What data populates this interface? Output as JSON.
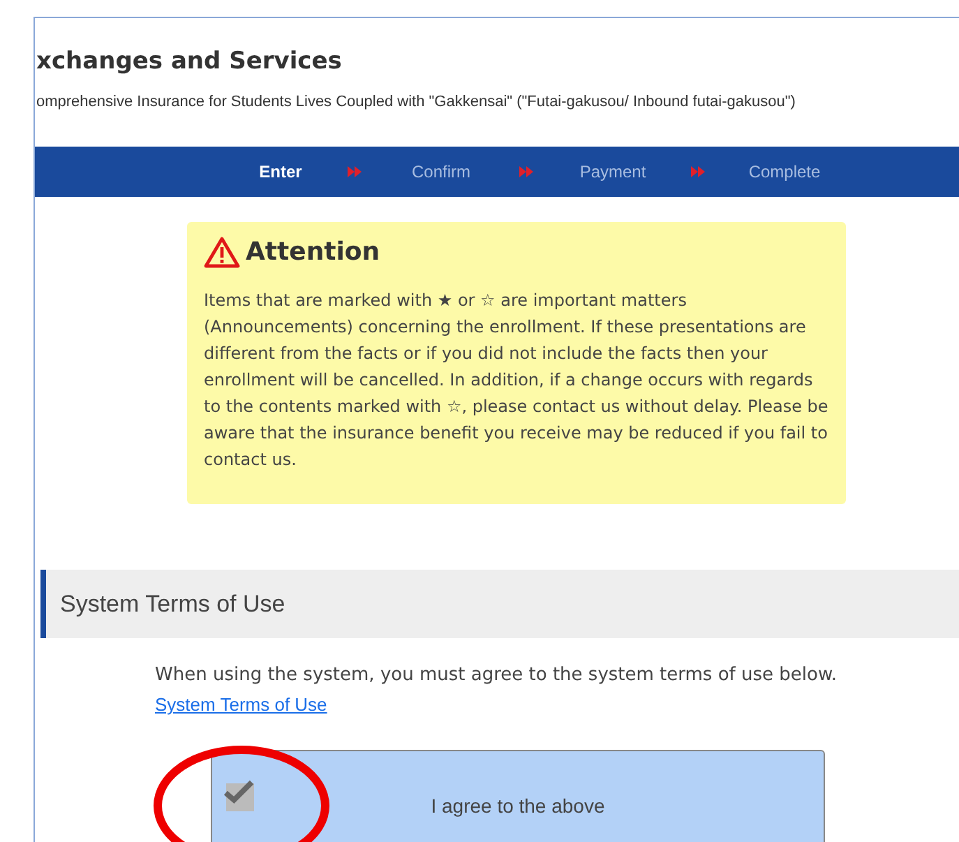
{
  "header": {
    "title": "xchanges and Services",
    "subtitle": "omprehensive Insurance for Students Lives Coupled with \"Gakkensai\" (\"Futai-gakusou/ Inbound futai-gakusou\")"
  },
  "steps": [
    {
      "label": "Enter",
      "selected": true
    },
    {
      "label": "Confirm",
      "selected": false
    },
    {
      "label": "Payment",
      "selected": false
    },
    {
      "label": "Complete",
      "selected": false
    }
  ],
  "attention": {
    "title": "Attention",
    "body": "Items that are marked with ★ or ☆ are important matters (Announcements) concerning the enrollment. If these presentations are different from the facts or if you did not include the facts then your enrollment will be cancelled. In addition, if a change occurs with regards to the contents marked with ☆, please contact us without delay. Please be aware that the insurance benefit you receive may be reduced if you fail to contact us."
  },
  "section": {
    "title": "System Terms of Use",
    "intro": "When using the system, you must agree to the system terms of use below.",
    "link": "System Terms of Use"
  },
  "agree": {
    "label": "I agree to the above",
    "checked": true
  }
}
